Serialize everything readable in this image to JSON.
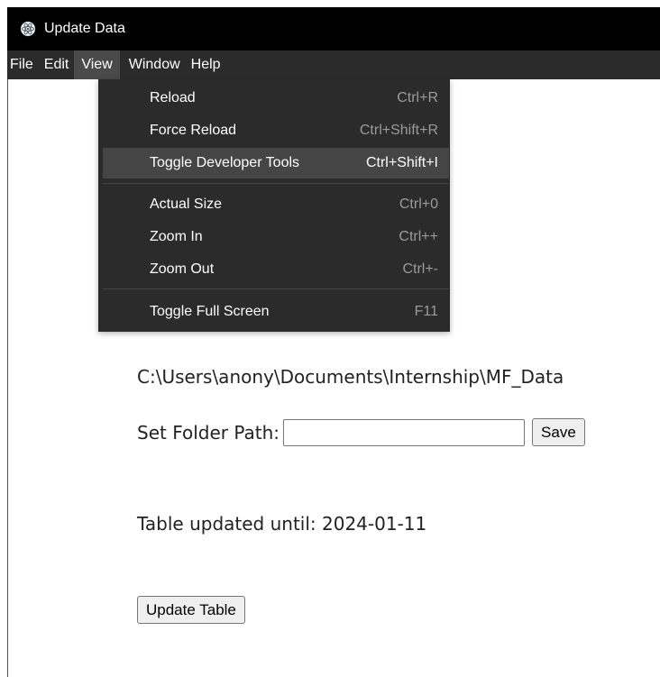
{
  "window": {
    "title": "Update Data"
  },
  "menubar": {
    "items": [
      "File",
      "Edit",
      "View",
      "Window",
      "Help"
    ],
    "active": "View"
  },
  "view_menu": {
    "items": [
      {
        "label": "Reload",
        "accelerator": "Ctrl+R"
      },
      {
        "label": "Force Reload",
        "accelerator": "Ctrl+Shift+R"
      },
      {
        "label": "Toggle Developer Tools",
        "accelerator": "Ctrl+Shift+I",
        "highlighted": true
      },
      {
        "label": "Actual Size",
        "accelerator": "Ctrl+0"
      },
      {
        "label": "Zoom In",
        "accelerator": "Ctrl++"
      },
      {
        "label": "Zoom Out",
        "accelerator": "Ctrl+-"
      },
      {
        "label": "Toggle Full Screen",
        "accelerator": "F11"
      }
    ]
  },
  "main": {
    "folder_path": "C:\\Users\\anony\\Documents\\Internship\\MF_Data",
    "set_folder_label": "Set Folder Path:",
    "folder_input_value": "",
    "save_label": "Save",
    "table_updated_text": "Table updated until: 2024-01-11",
    "update_button_label": "Update Table"
  },
  "colors": {
    "titlebar": "#000000",
    "menubar": "#2b2b2b",
    "menu_highlight": "#454545"
  },
  "icons": {
    "app_icon": "electron-atom-icon"
  }
}
